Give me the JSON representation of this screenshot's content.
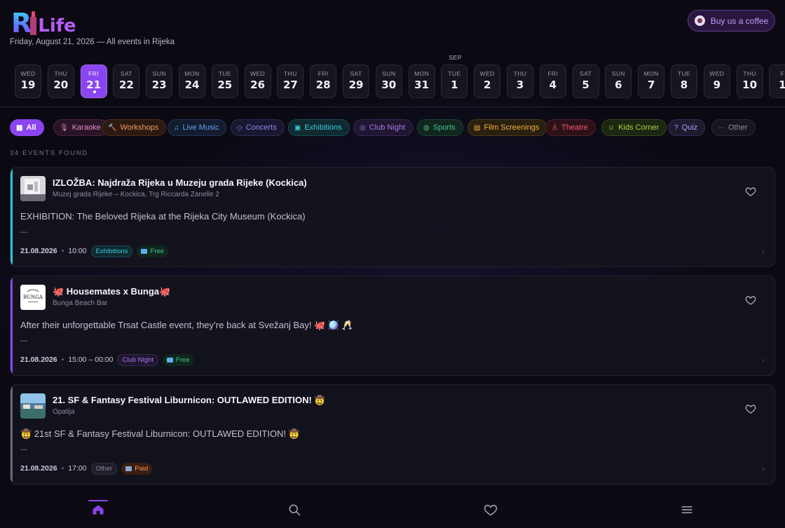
{
  "header": {
    "logo_r": "R",
    "logo_life": "Life",
    "subtitle": "Friday, August 21, 2026 — All events in Rijeka",
    "coffee_label": "Buy us a coffee"
  },
  "date_strip": {
    "month_marker": "SEP",
    "days": [
      {
        "dow": "WED",
        "day": "19",
        "active": false
      },
      {
        "dow": "THU",
        "day": "20",
        "active": false
      },
      {
        "dow": "FRI",
        "day": "21",
        "active": true
      },
      {
        "dow": "SAT",
        "day": "22",
        "active": false
      },
      {
        "dow": "SUN",
        "day": "23",
        "active": false
      },
      {
        "dow": "MON",
        "day": "24",
        "active": false
      },
      {
        "dow": "TUE",
        "day": "25",
        "active": false
      },
      {
        "dow": "WED",
        "day": "26",
        "active": false
      },
      {
        "dow": "THU",
        "day": "27",
        "active": false
      },
      {
        "dow": "FRI",
        "day": "28",
        "active": false
      },
      {
        "dow": "SAT",
        "day": "29",
        "active": false
      },
      {
        "dow": "SUN",
        "day": "30",
        "active": false
      },
      {
        "dow": "MON",
        "day": "31",
        "active": false
      },
      {
        "dow": "TUE",
        "day": "1",
        "active": false
      },
      {
        "dow": "WED",
        "day": "2",
        "active": false
      },
      {
        "dow": "THU",
        "day": "3",
        "active": false
      },
      {
        "dow": "FRI",
        "day": "4",
        "active": false
      },
      {
        "dow": "SAT",
        "day": "5",
        "active": false
      },
      {
        "dow": "SUN",
        "day": "6",
        "active": false
      },
      {
        "dow": "MON",
        "day": "7",
        "active": false
      },
      {
        "dow": "TUE",
        "day": "8",
        "active": false
      },
      {
        "dow": "WED",
        "day": "9",
        "active": false
      },
      {
        "dow": "THU",
        "day": "10",
        "active": false
      },
      {
        "dow": "F",
        "day": "1",
        "active": false
      }
    ]
  },
  "filters": [
    {
      "label": "All",
      "icon": "grid-icon",
      "glyph": "▦",
      "fg": "#ffffff",
      "bg": "#8b45f0",
      "border": "#8b45f0"
    },
    {
      "label": "Karaoke",
      "icon": "microphone-icon",
      "glyph": "🎙",
      "fg": "#e889c8",
      "bg": "#2a1526",
      "border": "#4a2242"
    },
    {
      "label": "Workshops",
      "icon": "hammer-icon",
      "glyph": "🔨",
      "fg": "#f29a5a",
      "bg": "#2c1a12",
      "border": "#4d2c1a"
    },
    {
      "label": "Live Music",
      "icon": "music-note-icon",
      "glyph": "♫",
      "fg": "#6aa0f5",
      "bg": "#141c30",
      "border": "#23325a"
    },
    {
      "label": "Concerts",
      "icon": "ticket-icon",
      "glyph": "◇",
      "fg": "#8c86f0",
      "bg": "#1a1830",
      "border": "#2c2958"
    },
    {
      "label": "Exhibitions",
      "icon": "image-icon",
      "glyph": "▣",
      "fg": "#3ec8dc",
      "bg": "#0f2a30",
      "border": "#1a4a54"
    },
    {
      "label": "Club Night",
      "icon": "disc-icon",
      "glyph": "◎",
      "fg": "#a878f0",
      "bg": "#1f1630",
      "border": "#36265a"
    },
    {
      "label": "Sports",
      "icon": "ball-icon",
      "glyph": "◍",
      "fg": "#44c28a",
      "bg": "#10261e",
      "border": "#1c4434"
    },
    {
      "label": "Film Screenings",
      "icon": "film-icon",
      "glyph": "▤",
      "fg": "#f0b040",
      "bg": "#2a2010",
      "border": "#4c3a18"
    },
    {
      "label": "Theatre",
      "icon": "mask-icon",
      "glyph": "♙",
      "fg": "#f05a6a",
      "bg": "#2c1218",
      "border": "#4e1e28"
    },
    {
      "label": "Kids Corner",
      "icon": "smile-icon",
      "glyph": "☺",
      "fg": "#a8d848",
      "bg": "#1c2610",
      "border": "#34461c"
    },
    {
      "label": "Quiz",
      "icon": "question-icon",
      "glyph": "?",
      "fg": "#b49cf0",
      "bg": "#1e1a30",
      "border": "#342c58"
    },
    {
      "label": "Other",
      "icon": "dots-icon",
      "glyph": "⋯",
      "fg": "#8d899e",
      "bg": "#17161f",
      "border": "#2c2a38"
    }
  ],
  "events_found": "34 EVENTS FOUND",
  "events": [
    {
      "title": "IZLOŽBA: Najdraža Rijeka u Muzeju grada Rijeke (Kockica)",
      "venue": "Muzej grada Rijeke – Kockica, Trg Riccarda Zanelle 2",
      "description": "EXHIBITION: The Beloved Rijeka at the Rijeka City Museum (Kockica)",
      "ellipsis": "...",
      "date": "21.08.2026",
      "time": "10:00",
      "category": "Exhibitions",
      "price": "Free",
      "accent": "#2ec4d8",
      "tag_fg": "#3ec8dc",
      "tag_bg": "#0f2a30",
      "tag_border": "#1a4a54",
      "thumb": "museum"
    },
    {
      "title": "🐙 Housemates x Bunga🐙",
      "venue": "Bunga Beach Bar",
      "description": "After their unforgettable Trsat Castle event, they’re back at Svežanj Bay! 🐙 🪩 🥂",
      "ellipsis": "...",
      "date": "21.08.2026",
      "time": "15:00 – 00:00",
      "category": "Club Night",
      "price": "Free",
      "accent": "#8b45f0",
      "tag_fg": "#a878f0",
      "tag_bg": "#1f1630",
      "tag_border": "#36265a",
      "thumb": "bunga"
    },
    {
      "title": "21. SF & Fantasy Festival Liburnicon: OUTLAWED EDITION! 🤠",
      "venue": "Opatija",
      "description": "🤠 21st SF & Fantasy Festival Liburnicon: OUTLAWED EDITION! 🤠",
      "ellipsis": "...",
      "date": "21.08.2026",
      "time": "17:00",
      "category": "Other",
      "price": "Paid",
      "accent": "#6a6878",
      "tag_fg": "#8d899e",
      "tag_bg": "#1e1d28",
      "tag_border": "#34323f",
      "thumb": "coast"
    }
  ],
  "nav": [
    {
      "name": "nav-home",
      "icon": "home-icon",
      "active": true
    },
    {
      "name": "nav-search",
      "icon": "search-icon",
      "active": false
    },
    {
      "name": "nav-favorites",
      "icon": "heart-icon",
      "active": false
    },
    {
      "name": "nav-menu",
      "icon": "menu-icon",
      "active": false
    }
  ],
  "colors": {
    "accent": "#8b45f0",
    "free_fg": "#44c28a",
    "free_bg": "#10261e",
    "paid_fg": "#f29a5a",
    "paid_bg": "#3a1e10"
  }
}
